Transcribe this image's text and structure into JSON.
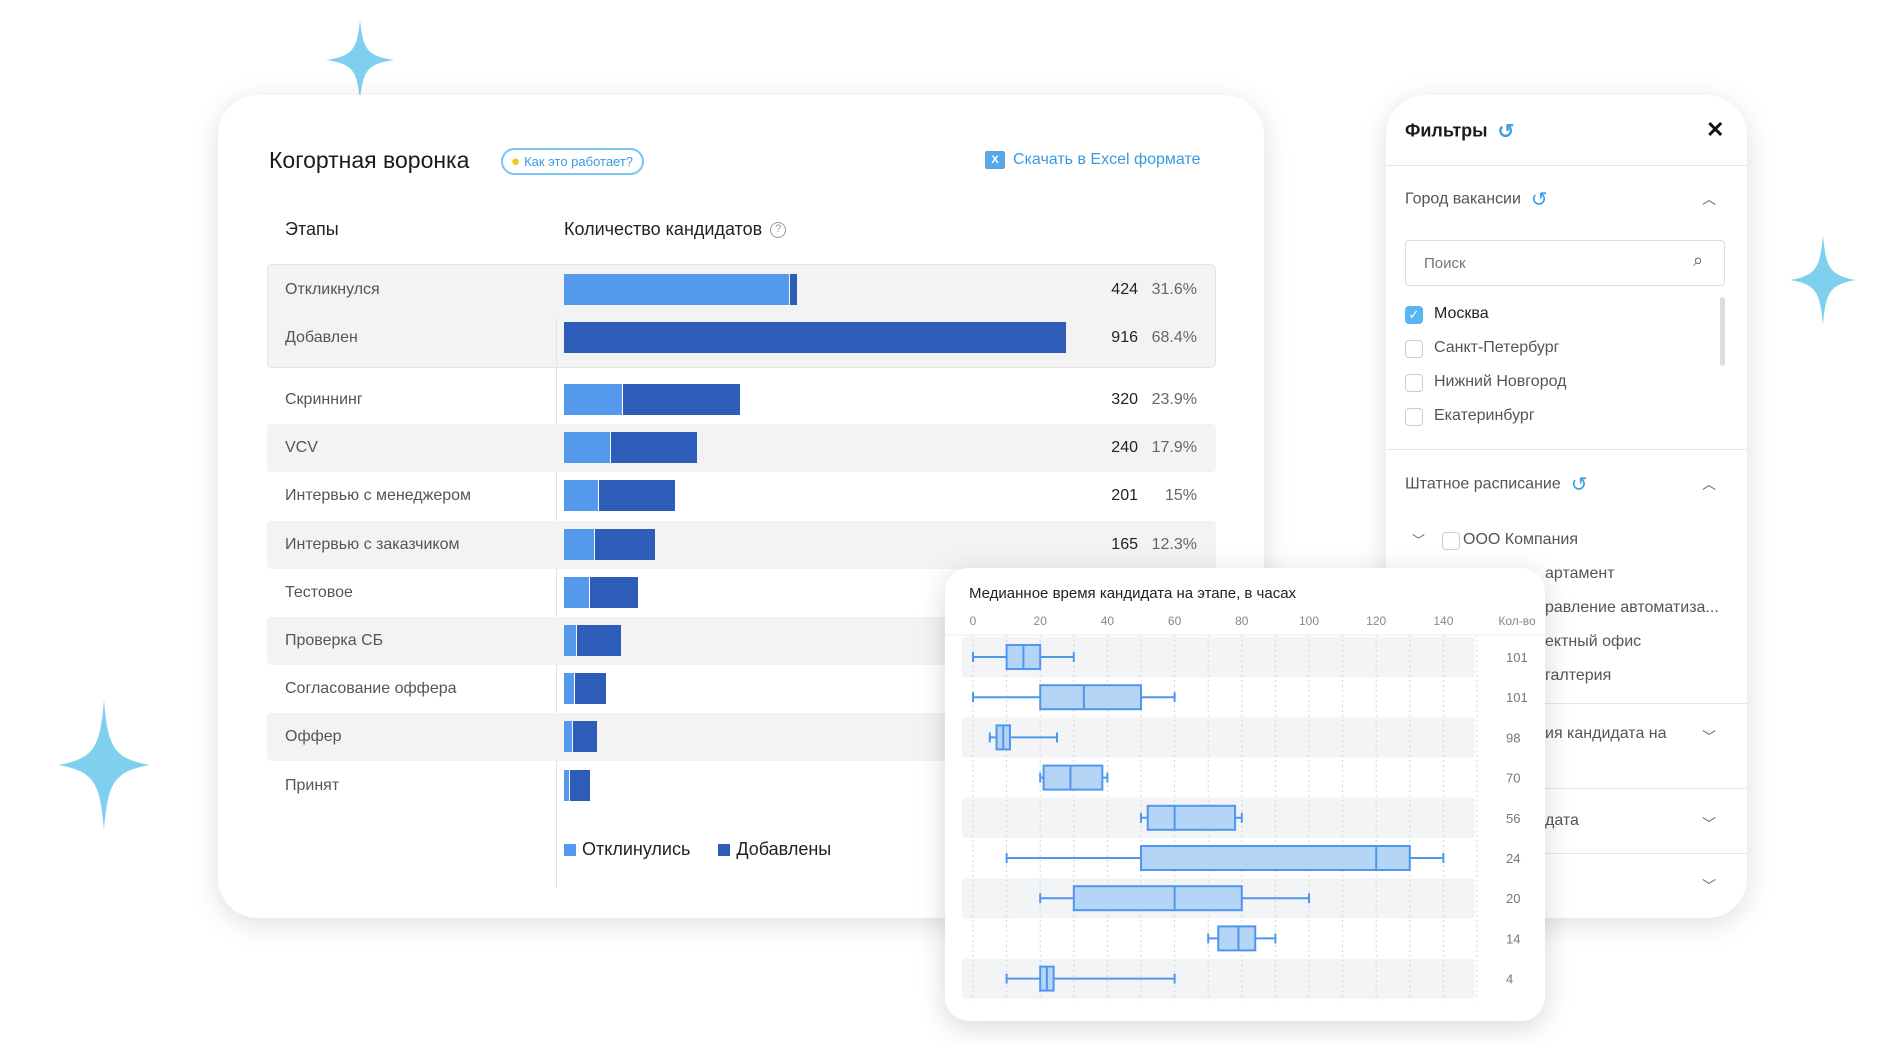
{
  "funnel": {
    "title": "Когортная воронка",
    "help_label": "Как это работает?",
    "excel_label": "Скачать в Excel формате",
    "col_stages": "Этапы",
    "col_count": "Количество кандидатов",
    "legend": {
      "responded": "Отклинулись",
      "added": "Добавлены"
    },
    "colors": {
      "responded": "#5599ec",
      "added": "#2d5db8"
    },
    "top_rows": [
      {
        "label": "Откликнулся",
        "responded": 410,
        "added": 14,
        "value": "424",
        "pct": "31.6%"
      },
      {
        "label": "Добавлен",
        "responded": 0,
        "added": 916,
        "value": "916",
        "pct": "68.4%"
      }
    ],
    "rows": [
      {
        "label": "Скриннинг",
        "responded": 106,
        "added": 214,
        "value": "320",
        "pct": "23.9%"
      },
      {
        "label": "VCV",
        "responded": 84,
        "added": 156,
        "value": "240",
        "pct": "17.9%"
      },
      {
        "label": "Интервью с менеджером",
        "responded": 62,
        "added": 139,
        "value": "201",
        "pct": "15%"
      },
      {
        "label": "Интервью с заказчиком",
        "responded": 55,
        "added": 110,
        "value": "165",
        "pct": "12.3%"
      },
      {
        "label": "Тестовое",
        "responded": 46,
        "added": 87
      },
      {
        "label": "Проверка СБ",
        "responded": 22,
        "added": 80
      },
      {
        "label": "Согласование оффера",
        "responded": 18,
        "added": 57
      },
      {
        "label": "Оффер",
        "responded": 15,
        "added": 43
      },
      {
        "label": "Принят",
        "responded": 9,
        "added": 37
      }
    ]
  },
  "filters": {
    "title": "Фильтры",
    "city": {
      "title": "Город вакансии",
      "search_placeholder": "Поиск",
      "options": [
        {
          "label": "Москва",
          "checked": true
        },
        {
          "label": "Санкт-Петербург",
          "checked": false
        },
        {
          "label": "Нижний Новгород",
          "checked": false
        },
        {
          "label": "Екатеринбург",
          "checked": false
        }
      ]
    },
    "staff": {
      "title": "Штатное расписание",
      "root": "ООО Компания",
      "children": [
        "артамент",
        "равление автоматиза...",
        "ектный офис",
        "галтерия"
      ]
    },
    "collapsed": [
      "ия кандидата на",
      "дата",
      ""
    ]
  },
  "chart_data": {
    "type": "boxplot",
    "title": "Медианное время кандидата на этапе, в часах",
    "xlim": [
      0,
      150
    ],
    "xticks": [
      0,
      20,
      40,
      60,
      80,
      100,
      120,
      140
    ],
    "count_header": "Кол-во",
    "grid": true,
    "color": "#4f97ee",
    "series": [
      {
        "min": 0,
        "q1": 10,
        "median": 15,
        "q3": 20,
        "max": 30,
        "count": "101"
      },
      {
        "min": 0,
        "q1": 20,
        "median": 33,
        "q3": 50,
        "max": 60,
        "count": "101"
      },
      {
        "min": 5,
        "q1": 7,
        "median": 9,
        "q3": 11,
        "max": 25,
        "count": "98"
      },
      {
        "min": 20,
        "q1": 21,
        "median": 29,
        "q3": 38.5,
        "max": 40,
        "count": "70"
      },
      {
        "min": 50,
        "q1": 52,
        "median": 60,
        "q3": 78,
        "max": 80,
        "count": "56"
      },
      {
        "min": 10,
        "q1": 50,
        "median": 120,
        "q3": 130,
        "max": 140,
        "count": "24"
      },
      {
        "min": 20,
        "q1": 30,
        "median": 60,
        "q3": 80,
        "max": 100,
        "count": "20"
      },
      {
        "min": 70,
        "q1": 73,
        "median": 79,
        "q3": 84,
        "max": 90,
        "count": "14"
      },
      {
        "min": 10,
        "q1": 20,
        "median": 22,
        "q3": 24,
        "max": 60,
        "count": "4"
      }
    ]
  }
}
